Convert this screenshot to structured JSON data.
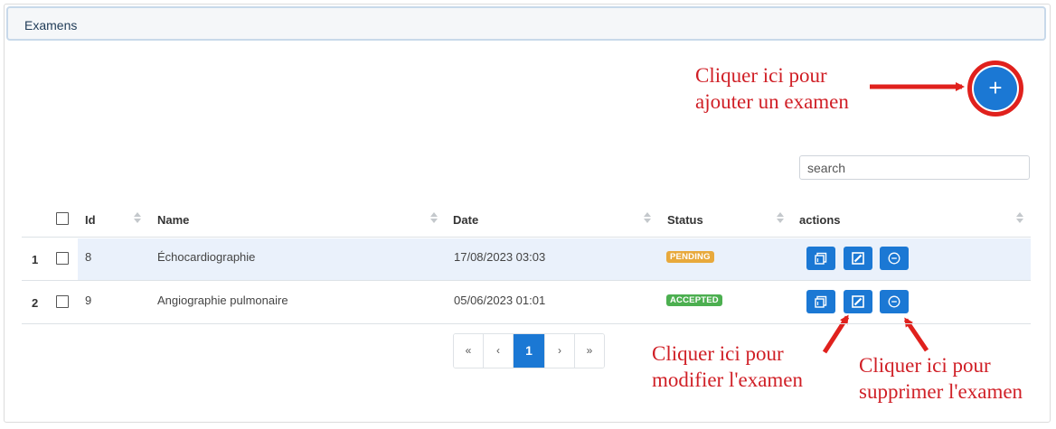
{
  "panel": {
    "title": "Examens"
  },
  "add_button": {
    "label": "+"
  },
  "annotations": {
    "add": [
      "Cliquer ici pour",
      "ajouter un examen"
    ],
    "edit": [
      "Cliquer ici pour",
      "modifier l'examen"
    ],
    "delete": [
      "Cliquer ici pour",
      "supprimer l'examen"
    ]
  },
  "search": {
    "placeholder": "search"
  },
  "table": {
    "columns": [
      "Id",
      "Name",
      "Date",
      "Status",
      "actions"
    ],
    "rows": [
      {
        "num": "1",
        "id": "8",
        "name": "Échocardiographie",
        "date": "17/08/2023 03:03",
        "status": "PENDING",
        "status_color": "#e8a93c"
      },
      {
        "num": "2",
        "id": "9",
        "name": "Angiographie pulmonaire",
        "date": "05/06/2023 01:01",
        "status": "ACCEPTED",
        "status_color": "#4caf50"
      }
    ]
  },
  "pagination": {
    "first": "«",
    "prev": "‹",
    "current": "1",
    "next": "›",
    "last": "»"
  },
  "colors": {
    "primary": "#1b78d4",
    "annotation": "#d01f26"
  }
}
